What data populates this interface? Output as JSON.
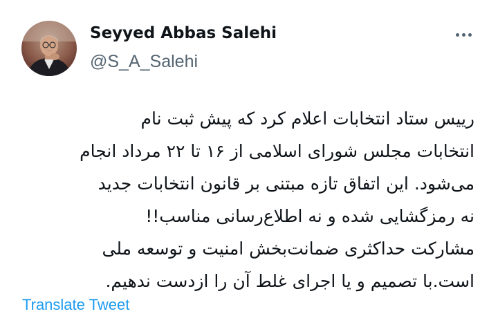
{
  "tweet": {
    "author": {
      "display_name": "Seyyed Abbas Salehi",
      "handle": "@S_A_Salehi",
      "avatar_icon": "person-portrait"
    },
    "more_icon": "three-dots-horizontal-icon",
    "text_lines": [
      "رییس ستاد انتخابات اعلام کرد که پیش ثبت نام",
      "انتخابات مجلس شورای اسلامی از ۱۶ تا ۲۲ مرداد انجام",
      "می‌شود. این اتفاق تازه مبتنی بر قانون انتخابات جدید",
      "نه رمزگشایی شده و نه اطلاع‌رسانی مناسب!!",
      "مشارکت حداکثری ضمانت‌بخش امنیت و توسعه ملی",
      "است.با تصمیم و یا اجرای غلط آن را ازدست ندهیم."
    ],
    "translate_label": "Translate Tweet"
  },
  "colors": {
    "text_primary": "#0f1419",
    "text_secondary": "#536471",
    "link": "#1d9bf0",
    "background": "#ffffff"
  }
}
